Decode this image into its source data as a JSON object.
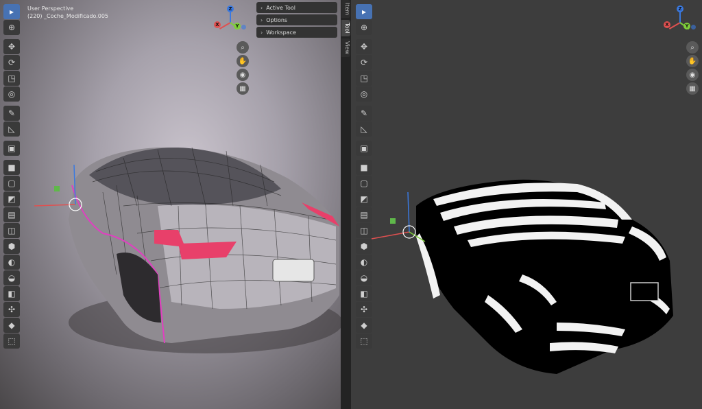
{
  "left_viewport": {
    "perspective_label": "User Perspective",
    "object_label": "(220) _Coche_Modificado.005",
    "panel_tabs": [
      "Active Tool",
      "Options",
      "Workspace"
    ],
    "side_tabs": [
      "Item",
      "Tool",
      "View"
    ]
  },
  "gizmo": {
    "x": "X",
    "y": "Y",
    "z": "Z"
  },
  "toolbar": {
    "tools": [
      "select-box",
      "cursor",
      "move",
      "rotate",
      "scale",
      "transform",
      "annotate",
      "measure",
      "add-cube",
      "extrude",
      "inset",
      "bevel",
      "loop-cut",
      "knife",
      "poly-build",
      "spin",
      "smooth",
      "edge-slide",
      "shrink-fatten",
      "shear",
      "rip"
    ]
  },
  "nav": [
    "zoom",
    "pan",
    "camera",
    "grid"
  ],
  "colors": {
    "accent": "#4772b3",
    "axis_x": "#e05050",
    "axis_y": "#7ecf3a",
    "axis_z": "#3a79e0"
  }
}
